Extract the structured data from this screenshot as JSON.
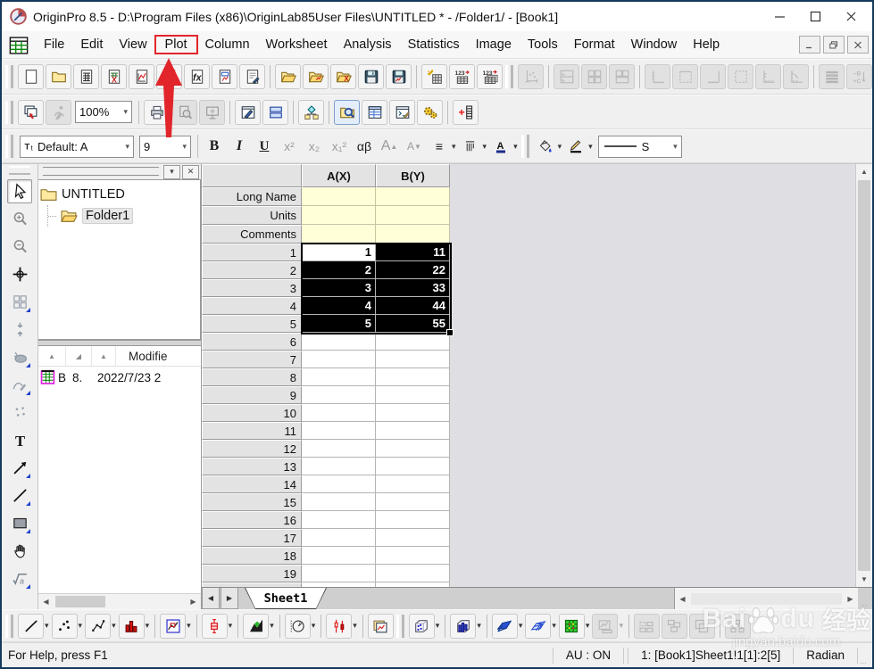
{
  "window": {
    "title": "OriginPro 8.5 - D:\\Program Files (x86)\\OriginLab85User Files\\UNTITLED * - /Folder1/ - [Book1]"
  },
  "menu": {
    "items": [
      "File",
      "Edit",
      "View",
      "Plot",
      "Column",
      "Worksheet",
      "Analysis",
      "Statistics",
      "Image",
      "Tools",
      "Format",
      "Window",
      "Help"
    ],
    "highlighted": "Plot"
  },
  "toolbars": {
    "zoom_value": "100%",
    "standard": [
      {
        "type": "handle"
      },
      {
        "icon": "new-project"
      },
      {
        "icon": "new-folder"
      },
      {
        "icon": "new-workbook"
      },
      {
        "icon": "new-excel"
      },
      {
        "icon": "new-graph"
      },
      {
        "icon": "new-matrix"
      },
      {
        "icon": "new-function"
      },
      {
        "icon": "new-layout"
      },
      {
        "icon": "new-notes"
      },
      {
        "type": "sep"
      },
      {
        "icon": "open"
      },
      {
        "icon": "open-template"
      },
      {
        "icon": "open-excel"
      },
      {
        "icon": "save"
      },
      {
        "icon": "save-template"
      },
      {
        "type": "sep"
      },
      {
        "icon": "import-wizard"
      },
      {
        "icon": "import-ascii"
      },
      {
        "icon": "import-multiple-ascii"
      },
      {
        "type": "handle"
      },
      {
        "icon": "rescale-axes",
        "disabled": true
      },
      {
        "type": "sep"
      },
      {
        "icon": "layer-top",
        "disabled": true
      },
      {
        "icon": "layer-4-grid",
        "disabled": true
      },
      {
        "icon": "layer-4-alt",
        "disabled": true
      },
      {
        "type": "sep"
      },
      {
        "icon": "frame-corner",
        "disabled": true
      },
      {
        "icon": "frame-open-top",
        "disabled": true
      },
      {
        "icon": "frame-right",
        "disabled": true
      },
      {
        "icon": "frame-box",
        "disabled": true
      },
      {
        "icon": "frame-ticks",
        "disabled": true
      },
      {
        "icon": "frame-ticks-in",
        "disabled": true
      },
      {
        "type": "sep"
      },
      {
        "icon": "thick-lines",
        "disabled": true
      },
      {
        "icon": "swap-bc",
        "disabled": true
      },
      {
        "icon": "column-list",
        "disabled": true
      },
      {
        "icon": "clock",
        "disabled": true
      }
    ],
    "row2": [
      {
        "type": "handle"
      },
      {
        "icon": "duplicate-batch-plot"
      },
      {
        "icon": "run-script",
        "disabled": true
      },
      {
        "type": "combo",
        "icon": "zoom-combo",
        "bind": "toolbars.zoom_value",
        "width": 64
      },
      {
        "type": "sep"
      },
      {
        "icon": "print"
      },
      {
        "icon": "print-preview",
        "disabled": true
      },
      {
        "icon": "slide-show",
        "disabled": true
      },
      {
        "type": "sep"
      },
      {
        "icon": "new-notes-window"
      },
      {
        "icon": "split-view"
      },
      {
        "type": "sep"
      },
      {
        "icon": "project-explorer-toggle"
      },
      {
        "type": "sep"
      },
      {
        "icon": "view-project-folder",
        "active": true
      },
      {
        "icon": "results-log"
      },
      {
        "icon": "script-window"
      },
      {
        "icon": "code-builder"
      },
      {
        "type": "sep"
      },
      {
        "icon": "add-new-columns"
      }
    ],
    "format": {
      "font_label": "Default: A",
      "font_size": "9",
      "bold": "B",
      "italic": "I",
      "underline": "U",
      "superscript": "x²",
      "subscript": "x₂",
      "sub_superscript": "x₁²",
      "greek": "αβ",
      "font_larger": "A",
      "font_smaller": "A",
      "line_style_label": "S"
    },
    "plot2d": [
      {
        "type": "handle"
      },
      {
        "icon": "line-plot",
        "caret": true
      },
      {
        "icon": "scatter-plot",
        "caret": true
      },
      {
        "icon": "line-symbol-plot",
        "caret": true
      },
      {
        "icon": "column-plot",
        "caret": true
      },
      {
        "type": "sep"
      },
      {
        "icon": "zoom-panel-plot",
        "caret": true
      },
      {
        "type": "sep"
      },
      {
        "icon": "box-plot",
        "caret": true
      },
      {
        "type": "sep"
      },
      {
        "icon": "area-plot",
        "caret": true
      },
      {
        "type": "sep"
      },
      {
        "icon": "polar-plot",
        "caret": true
      },
      {
        "type": "sep"
      },
      {
        "icon": "stock-plot",
        "caret": true
      },
      {
        "type": "sep"
      },
      {
        "icon": "template-library"
      },
      {
        "type": "handle"
      },
      {
        "icon": "3d-scatter-plot",
        "caret": true
      },
      {
        "type": "sep"
      },
      {
        "icon": "3d-bar-plot",
        "caret": true
      },
      {
        "type": "sep"
      },
      {
        "icon": "3d-surface-plot",
        "caret": true
      },
      {
        "icon": "3d-wireframe-plot",
        "caret": true
      },
      {
        "icon": "contour-plot",
        "caret": true
      },
      {
        "icon": "insert-graph",
        "disabled": true,
        "caret": true
      },
      {
        "type": "sep"
      },
      {
        "icon": "arrange-horizontal",
        "disabled": true
      },
      {
        "icon": "arrange-grid",
        "disabled": true
      },
      {
        "icon": "arrange-cascade",
        "disabled": true
      },
      {
        "type": "sep"
      },
      {
        "icon": "group-objects",
        "disabled": true
      }
    ]
  },
  "palette": [
    {
      "icon": "pointer-tool",
      "active": true
    },
    {
      "icon": "zoom-in-tool",
      "disabled": true
    },
    {
      "icon": "zoom-out-tool",
      "disabled": true
    },
    {
      "icon": "screen-reader-tool"
    },
    {
      "icon": "regional-select-tool",
      "disabled": true,
      "flyout": true
    },
    {
      "icon": "data-selector-tool",
      "disabled": true
    },
    {
      "icon": "mask-range-tool",
      "disabled": true,
      "flyout": true
    },
    {
      "icon": "draw-data-tool",
      "disabled": true,
      "flyout": true
    },
    {
      "icon": "data-points-tool",
      "disabled": true
    },
    {
      "icon": "text-tool"
    },
    {
      "icon": "arrow-tool",
      "flyout": true
    },
    {
      "icon": "line-tool",
      "flyout": true
    },
    {
      "icon": "rectangle-tool",
      "flyout": true
    },
    {
      "icon": "pan-tool"
    },
    {
      "icon": "equation-tool",
      "flyout": true
    }
  ],
  "project_explorer": {
    "root_label": "UNTITLED",
    "folder_label": "Folder1",
    "list": {
      "modified_header": "Modifie",
      "item_name": "B",
      "item_size": "8.",
      "item_modified": "2022/7/23 2"
    }
  },
  "worksheet": {
    "columns": [
      "A(X)",
      "B(Y)"
    ],
    "label_rows": [
      "Long Name",
      "Units",
      "Comments"
    ],
    "data_rows": [
      {
        "n": "1",
        "a": "1",
        "b": "11"
      },
      {
        "n": "2",
        "a": "2",
        "b": "22"
      },
      {
        "n": "3",
        "a": "3",
        "b": "33"
      },
      {
        "n": "4",
        "a": "4",
        "b": "44"
      },
      {
        "n": "5",
        "a": "5",
        "b": "55"
      }
    ],
    "visible_row_count": 20,
    "selected_rows": [
      1,
      2,
      3,
      4,
      5
    ],
    "active_cell": "A1",
    "sheet_tab": "Sheet1"
  },
  "status_bar": {
    "help": "For Help, press F1",
    "autoupdate": "AU : ON",
    "selection": "1: [Book1]Sheet1!1[1]:2[5]",
    "angle_unit": "Radian"
  },
  "watermark": {
    "brand_left": "Bai",
    "brand_right": "du",
    "brand_cn": "经验",
    "url": "jingyan.baidu.com"
  },
  "annotations": {
    "highlight_color": "#e2252b"
  }
}
